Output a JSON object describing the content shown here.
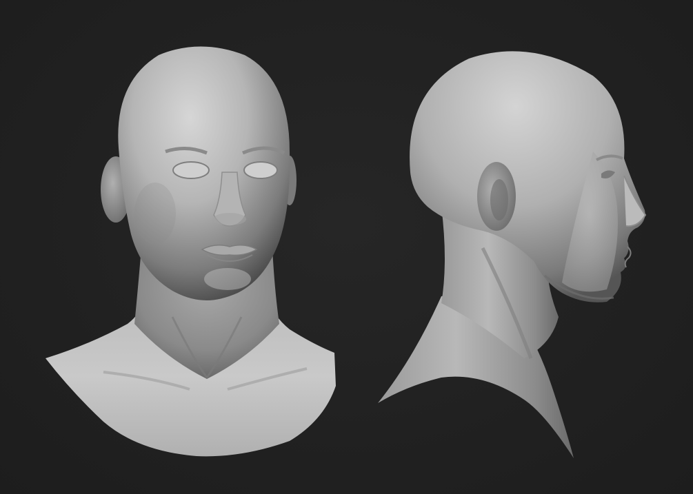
{
  "scene": {
    "background_color": "#202020",
    "subject_color": "#bdbdbd",
    "views": [
      {
        "name": "front-view",
        "description_icon": "head-bust-front"
      },
      {
        "name": "side-view",
        "description_icon": "head-bust-profile-right"
      }
    ]
  }
}
